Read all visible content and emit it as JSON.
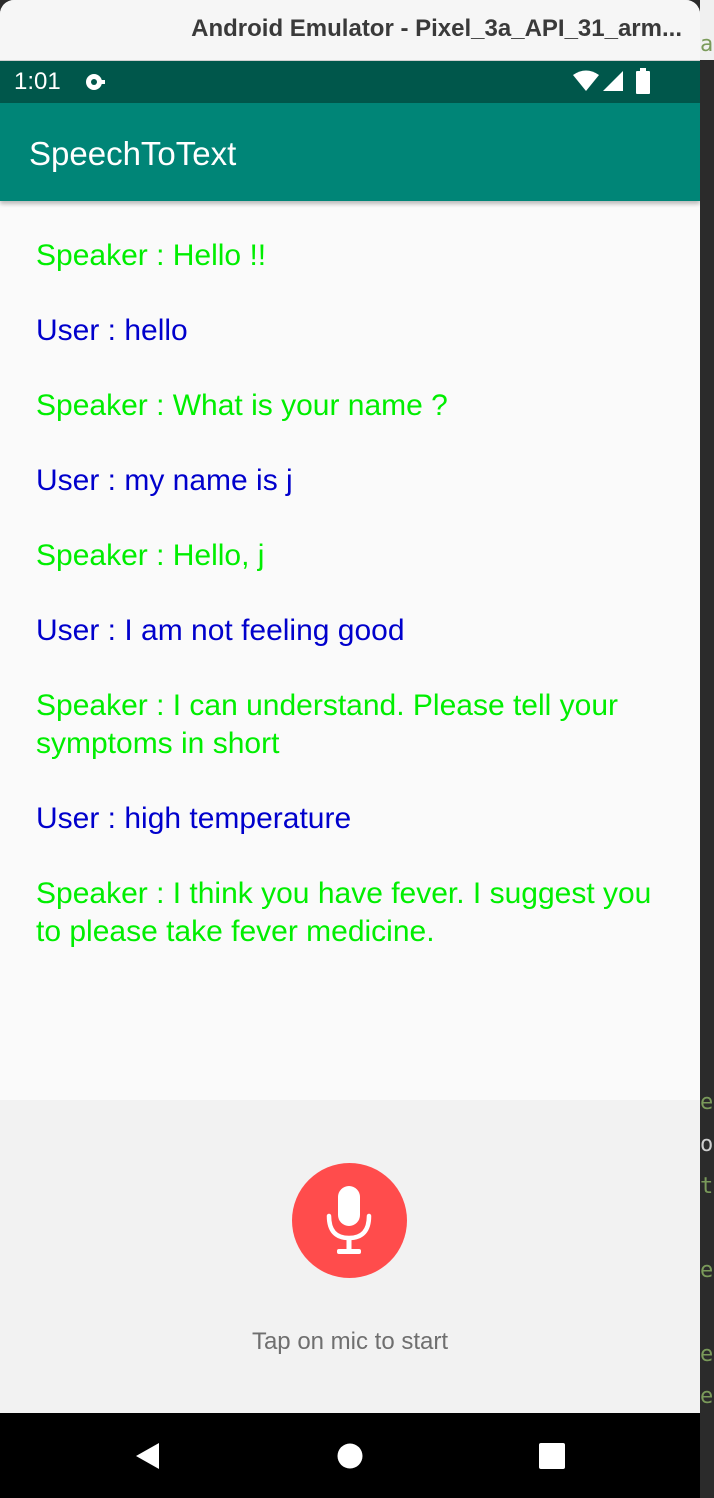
{
  "window": {
    "title": "Android Emulator - Pixel_3a_API_31_arm..."
  },
  "status_bar": {
    "time": "1:01",
    "icons": [
      "notification-icon",
      "wifi-icon",
      "signal-icon",
      "battery-icon"
    ]
  },
  "app_bar": {
    "title": "SpeechToText"
  },
  "conversation": [
    {
      "role": "speaker",
      "text": "Speaker : Hello !!"
    },
    {
      "role": "user",
      "text": "User : hello"
    },
    {
      "role": "speaker",
      "text": "Speaker : What is your name ?"
    },
    {
      "role": "user",
      "text": "User : my name is j"
    },
    {
      "role": "speaker",
      "text": "Speaker : Hello, j"
    },
    {
      "role": "user",
      "text": "User : I am not feeling good"
    },
    {
      "role": "speaker",
      "text": "Speaker : I can understand. Please tell your symptoms in short"
    },
    {
      "role": "user",
      "text": "User : high temperature"
    },
    {
      "role": "speaker",
      "text": "Speaker : I think you have fever. I suggest you to please take fever medicine."
    }
  ],
  "mic": {
    "icon": "microphone-icon",
    "hint": "Tap on mic to start"
  },
  "navigation": {
    "icons": [
      "back-icon",
      "home-icon",
      "recents-icon"
    ]
  },
  "ide_peek": {
    "lines": [
      "ar",
      "er",
      "o",
      "t",
      "er",
      "e",
      "er"
    ]
  },
  "colors": {
    "status_bar": "#00574b",
    "app_bar": "#008577",
    "speaker_text": "#00ee00",
    "user_text": "#0000cc",
    "mic_button": "#ff4c4c"
  }
}
